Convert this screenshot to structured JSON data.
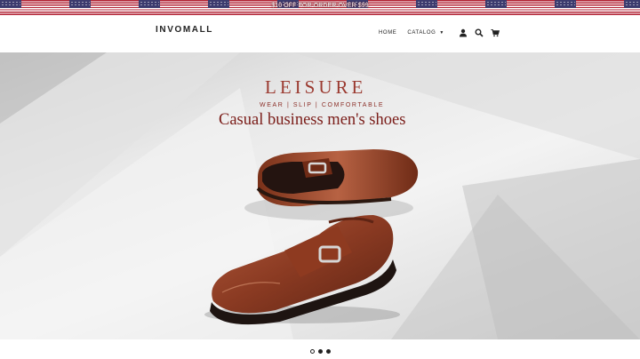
{
  "announcement": {
    "text": "$10 OFF FOR ORDER OVER $99"
  },
  "header": {
    "logo": "INVOMALL",
    "nav": [
      {
        "label": "HOME"
      },
      {
        "label": "CATALOG",
        "has_dropdown": true
      }
    ],
    "icons": [
      "account-icon",
      "search-icon",
      "cart-icon"
    ]
  },
  "hero": {
    "title": "LEISURE",
    "subtitle": "WEAR | SLIP | COMFORTABLE",
    "headline": "Casual business men's shoes",
    "image": "brown-leather-monk-strap-shoes"
  },
  "slider": {
    "slide_count": 3,
    "active_index": 0
  },
  "colors": {
    "hero_title": "#9b3a30",
    "hero_headline": "#7a1c18",
    "flag_red": "#b22234",
    "flag_blue": "#3c3b6e"
  }
}
